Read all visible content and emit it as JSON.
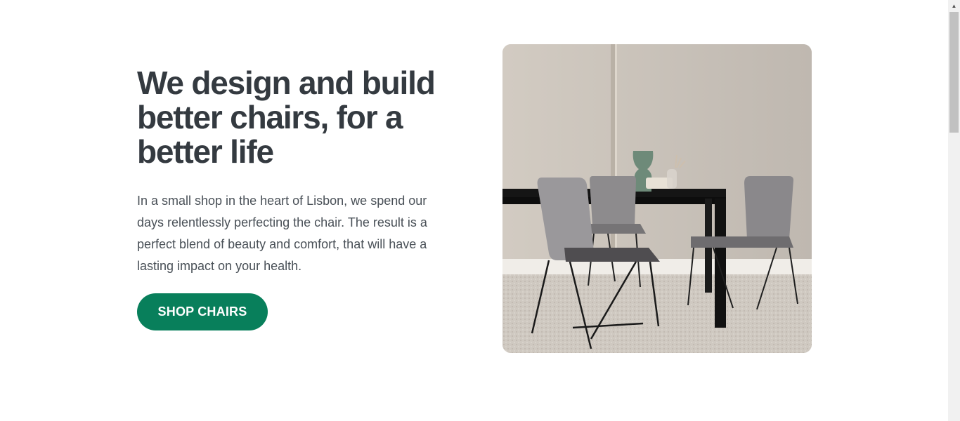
{
  "hero": {
    "title": "We design and build better chairs, for a better life",
    "description": "In a small shop in the heart of Lisbon, we spend our days relentlessly perfecting the chair. The result is a perfect blend of beauty and comfort, that will have a lasting impact on your health.",
    "cta_label": "SHOP CHAIRS",
    "image_subject": "dining table with grey upholstered chairs and vases"
  },
  "colors": {
    "heading": "#343a40",
    "body_text": "#495057",
    "accent": "#087f5b",
    "background": "#ffffff"
  },
  "scrollbar": {
    "up_arrow_icon": "triangle-up-icon"
  }
}
